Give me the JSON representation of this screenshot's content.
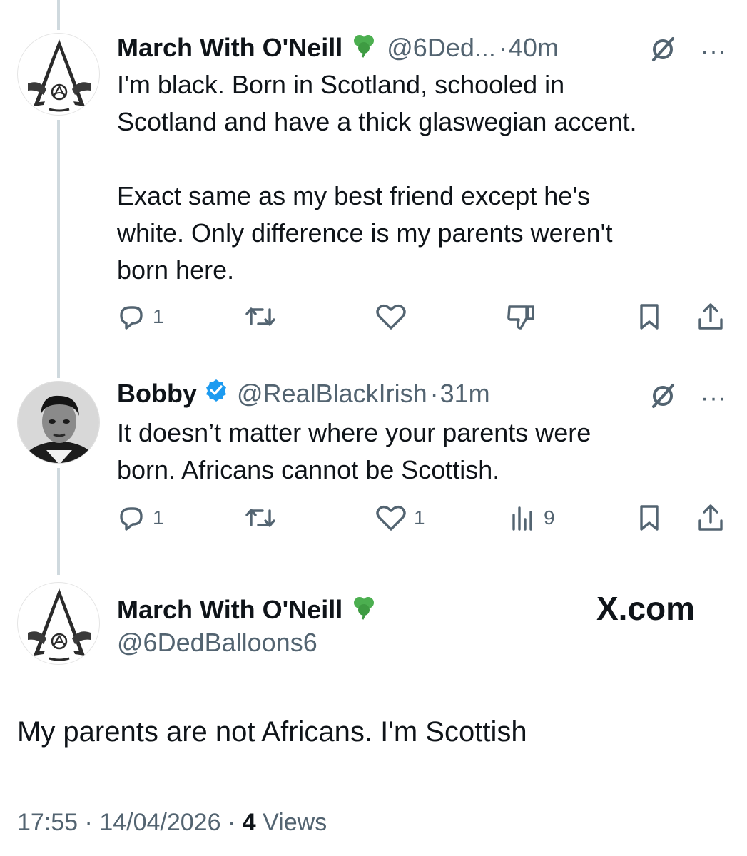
{
  "tweets": [
    {
      "name": "March With O'Neill",
      "name_icon": "shamrock-icon",
      "handle": "@6Ded...",
      "time": "40m",
      "text": "I'm black. Born in Scotland, schooled in\nScotland and have a thick glaswegian accent.\n\nExact same as my best friend except he's\nwhite. Only difference is my parents weren't\nborn here.",
      "actions": {
        "reply_count": "1",
        "retweet_count": "",
        "like_count": "",
        "views_count": ""
      },
      "fourth_action_icon": "thumbs-down-icon"
    },
    {
      "name": "Bobby",
      "name_icon": "verified-badge-icon",
      "handle": "@RealBlackIrish",
      "time": "31m",
      "text": "It doesn’t matter where your parents were\nborn. Africans cannot be Scottish.",
      "actions": {
        "reply_count": "1",
        "retweet_count": "",
        "like_count": "1",
        "views_count": "9"
      },
      "fourth_action_icon": "views-chart-icon"
    }
  ],
  "main_tweet": {
    "name": "March With O'Neill",
    "name_icon": "shamrock-icon",
    "handle": "@6DedBalloons6",
    "text": "My parents are not Africans. I'm Scottish",
    "time": "17:55",
    "date": "14/04/2026",
    "views_count": "4",
    "views_label": "Views"
  },
  "watermark": "X.com",
  "colors": {
    "text": "#0f1419",
    "muted": "#536471",
    "verified_blue": "#1d9bf0",
    "shamrock": "#4caf50",
    "thread_line": "#cfd9de"
  }
}
